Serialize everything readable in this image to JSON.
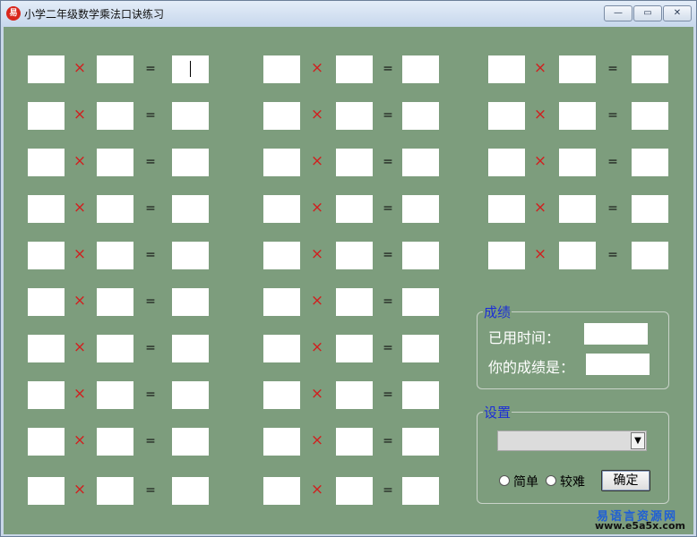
{
  "window": {
    "title": "小学二年级数学乘法口诀练习",
    "minimize_glyph": "—",
    "maximize_glyph": "▭",
    "close_glyph": "✕"
  },
  "problem": {
    "times_symbol": "×",
    "equals_symbol": "="
  },
  "score": {
    "legend": "成绩",
    "time_label": "已用时间：",
    "score_label": "你的成绩是：",
    "time_value": "",
    "score_value": ""
  },
  "settings": {
    "legend": "设置",
    "difficulty_selected": "",
    "option_easy": "简单",
    "option_hard": "较难",
    "ok_button": "确定"
  },
  "watermark": {
    "site_name": "易语言资源网",
    "url": "www.e5a5x.com"
  }
}
